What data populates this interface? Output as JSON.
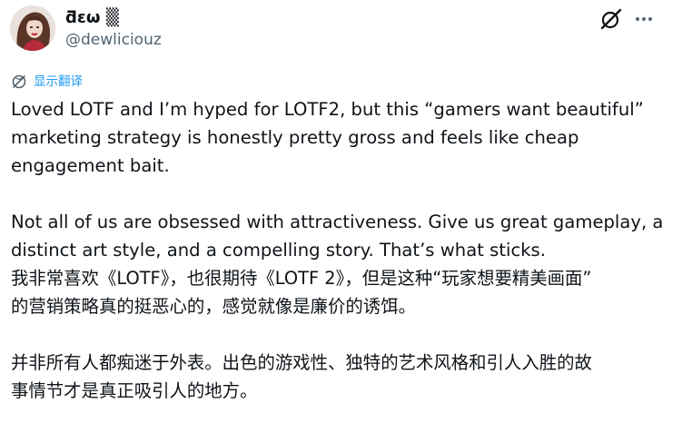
{
  "author": {
    "display_name": "ƌεω ▒",
    "handle": "@dewliciouz"
  },
  "header_icons": {
    "grok": "grok-icon",
    "more": "more-icon"
  },
  "translate": {
    "label": "显示翻译",
    "icon": "translate-globe-icon"
  },
  "tweet": {
    "en_lines": [
      "Loved LOTF and I’m hyped for LOTF2, but this “gamers want beautiful”",
      "marketing strategy is honestly pretty gross and feels like cheap",
      "engagement bait.",
      "Not all of us are obsessed with attractiveness. Give us great gameplay, a",
      "distinct art style, and a compelling story. That’s what sticks."
    ],
    "zh_lines": [
      "我非常喜欢《LOTF》，也很期待《LOTF 2》，但是这种“玩家想要精美画面”",
      "的营销策略真的挺恶心的，感觉就像是廉价的诱饵。",
      "并非所有人都痴迷于外表。出色的游戏性、独特的艺术风格和引人入胜的故",
      "事情节才是真正吸引人的地方。"
    ]
  },
  "colors": {
    "text": "#0f1419",
    "secondary": "#536471",
    "link": "#1d9bf0"
  }
}
